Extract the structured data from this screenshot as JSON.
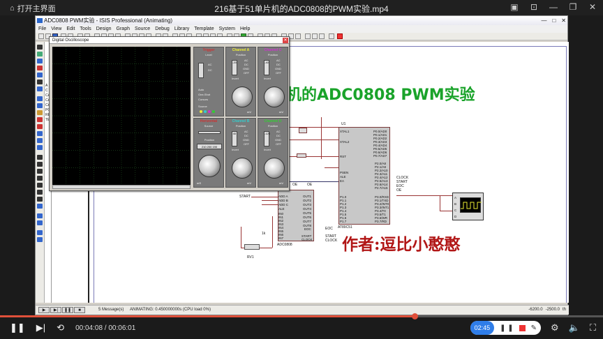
{
  "player": {
    "open_home": "打开主界面",
    "file_title": "216基于51单片机的ADC0808的PWM实验.mp4",
    "current_time": "00:04:08",
    "total_time": "00:06:01",
    "time_separator": " / ",
    "progress": 0.687,
    "record_time": "02:45"
  },
  "isis": {
    "window_title": "ADC0808 PWM实验 - ISIS Professional (Animating)",
    "menu": [
      "File",
      "View",
      "Edit",
      "Tools",
      "Design",
      "Graph",
      "Source",
      "Debug",
      "Library",
      "Template",
      "System",
      "Help"
    ],
    "device_list": [
      "A",
      "C",
      "CA",
      "CA",
      "CA",
      "PO",
      "RE",
      "TE"
    ],
    "status": {
      "messages": "5 Message(s)",
      "animating": "ANIMATING: 0.450000000s (CPU load 0%)",
      "coord_x": "-6200.0",
      "coord_y": "-2500.0",
      "unit": "th"
    }
  },
  "scope": {
    "title": "Digital Oscilloscope",
    "channel_a": "Channel A",
    "channel_b": "Channel B",
    "channel_c": "Channel C",
    "channel_d": "Channel D",
    "trigger": "Trigger",
    "horizontal": "Horizontal",
    "level": "Level",
    "position": "Position",
    "source": "Source",
    "auto": "Auto",
    "one_shot": "One-Shot",
    "cursors": "Cursors",
    "ac": "AC",
    "dc": "DC",
    "gnd": "GND",
    "off": "OFF",
    "invert": "Invert",
    "pos_a": "-20",
    "pos_b": "40",
    "pos_c": "-40",
    "pos_d": "-120",
    "h_position": "210 200 190",
    "v_unit": "mV",
    "t_unit": "mS"
  },
  "schematic": {
    "title": "机的ADC0808 PWM实验",
    "author": "作者:逗比小憨憨",
    "u1": "U1",
    "mcu_name": "AT89C51",
    "adc_name": "ADC0808",
    "rv1": "RV1",
    "rv1_value": "1k",
    "mcu_left_pins": [
      "XTAL1",
      "XTAL2",
      "RST",
      "PSEN",
      "ALE",
      "EA"
    ],
    "mcu_p1_pins": [
      "P1.0",
      "P1.1",
      "P1.2",
      "P1.3",
      "P1.4",
      "P1.5",
      "P1.6",
      "P1.7"
    ],
    "mcu_p0_pins": [
      "P0.0/AD0",
      "P0.1/AD1",
      "P0.2/AD2",
      "P0.3/AD3",
      "P0.4/AD4",
      "P0.5/AD5",
      "P0.6/AD6",
      "P0.7/AD7"
    ],
    "mcu_p2_pins": [
      "P2.0/A8",
      "P2.1/A9",
      "P2.2/A10",
      "P2.3/A11",
      "P2.4/A12",
      "P2.5/A13",
      "P2.6/A14",
      "P2.7/A15"
    ],
    "mcu_p3_pins": [
      "P3.0/RXD",
      "P3.1/TXD",
      "P3.2/INT0",
      "P3.3/INT1",
      "P3.4/T0",
      "P3.5/T1",
      "P3.6/WR",
      "P3.7/RD"
    ],
    "adc_left_pins": [
      "ADD A",
      "ADD B",
      "ADD C",
      "ALE",
      "IN0",
      "IN1",
      "IN2",
      "IN3",
      "IN4",
      "IN5",
      "IN6",
      "IN7"
    ],
    "adc_right_pins": [
      "OUT1",
      "OUT2",
      "OUT3",
      "OUT4",
      "OUT5",
      "OUT6",
      "OUT7",
      "OUT8",
      "EOC",
      "START",
      "CLOCK"
    ],
    "adc_top": "OE",
    "net_labels": [
      "CLOCK",
      "START",
      "EOC",
      "OE"
    ],
    "start_label": "START",
    "eoc_label": "EOC",
    "clock_label": "CLOCK",
    "oe_label": "OE",
    "scope_pins": [
      "A",
      "B",
      "C",
      "D"
    ]
  }
}
